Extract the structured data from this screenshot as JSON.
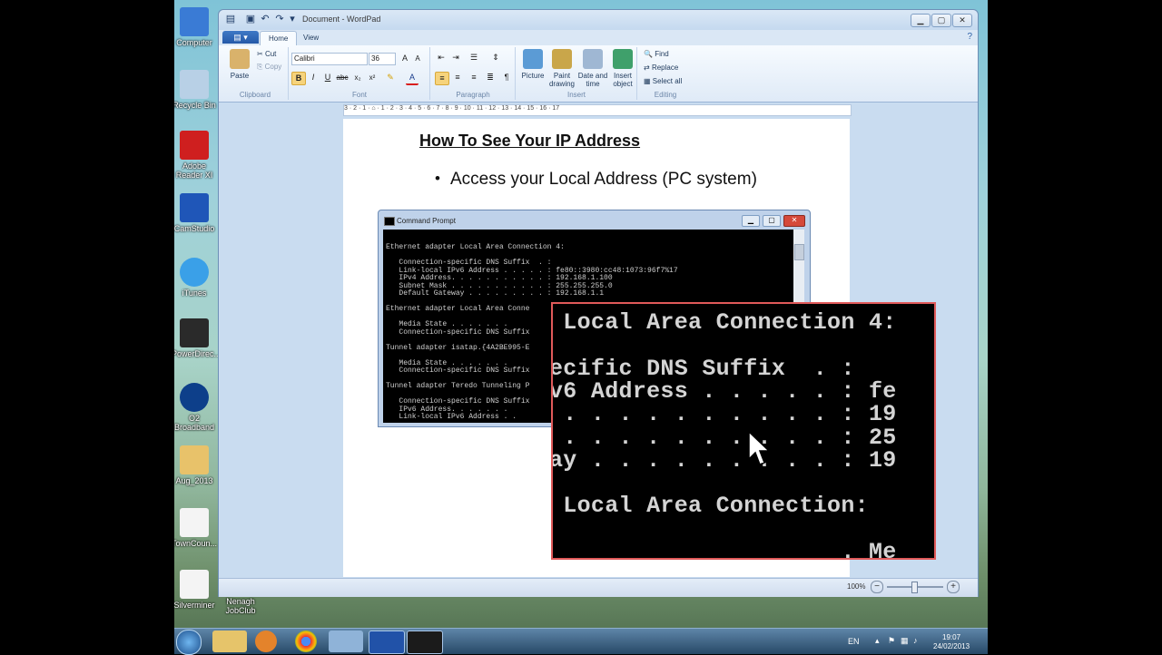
{
  "desktop": {
    "icons": [
      {
        "label": "Computer",
        "color": "#3a7bd5"
      },
      {
        "label": "Recycle Bin",
        "color": "#b8d0e6"
      },
      {
        "label": "Adobe Reader XI",
        "color": "#cf1f1f"
      },
      {
        "label": "CamStudio",
        "color": "#1f56b8"
      },
      {
        "label": "iTunes",
        "color": "#3aa0e8"
      },
      {
        "label": "PowerDirec...",
        "color": "#2a2a2a"
      },
      {
        "label": "O2 Broadband",
        "color": "#0d3f8a"
      },
      {
        "label": "Aug_2013",
        "color": "#e8c26a"
      },
      {
        "label": "TownCoun...",
        "color": "#f4f4f4"
      },
      {
        "label": "Silverminer",
        "color": "#f4f4f4"
      },
      {
        "label": "Nenagh JobClub",
        "color": "#f4f4f4"
      }
    ]
  },
  "wordpad": {
    "title": "Document - WordPad",
    "tabs": [
      "Home",
      "View"
    ],
    "ribbon": {
      "clipboard": {
        "paste": "Paste",
        "cut": "Cut",
        "copy": "Copy",
        "label": "Clipboard"
      },
      "font": {
        "family": "Calibri",
        "size": "36",
        "label": "Font"
      },
      "paragraph": {
        "label": "Paragraph"
      },
      "insert": {
        "picture": "Picture",
        "paint": "Paint drawing",
        "datetime": "Date and time",
        "object": "Insert object",
        "label": "Insert"
      },
      "editing": {
        "find": "Find",
        "replace": "Replace",
        "select_all": "Select all",
        "label": "Editing"
      }
    },
    "ruler": "3 · 2 · 1 · ⌂ · 1 · 2 · 3 · 4 · 5 · 6 · 7 · 8 · 9 · 10 · 11 · 12 · 13 · 14 · 15 · 16 · 17",
    "document": {
      "title": "How To See Your IP Address",
      "bullet": "Access your Local Address (PC system)"
    },
    "status": {
      "zoom": "100%"
    }
  },
  "cmd": {
    "title": "Command Prompt",
    "lines": [
      "Ethernet adapter Local Area Connection 4:",
      "",
      "   Connection-specific DNS Suffix  . :",
      "   Link-local IPv6 Address . . . . . : fe80::3980:cc48:1073:96f7%17",
      "   IPv4 Address. . . . . . . . . . . : 192.168.1.100",
      "   Subnet Mask . . . . . . . . . . . : 255.255.255.0",
      "   Default Gateway . . . . . . . . . : 192.168.1.1",
      "",
      "Ethernet adapter Local Area Conne",
      "",
      "   Media State . . . . . . .",
      "   Connection-specific DNS Suffix",
      "",
      "Tunnel adapter isatap.{4A2BE995-E",
      "",
      "   Media State . . . . . . .",
      "   Connection-specific DNS Suffix",
      "",
      "Tunnel adapter Teredo Tunneling P",
      "",
      "   Connection-specific DNS Suffix",
      "   IPv6 Address. . . . . . .",
      "   Link-local IPv6 Address . ."
    ]
  },
  "zoom": {
    "lines": [
      " Local Area Connection 4:",
      "",
      "ecific DNS Suffix  . :",
      "v6 Address . . . . . : fe",
      " . . . . . . . . . . : 19",
      " . . . . . . . . . . : 25",
      "ay . . . . . . . . . : 19",
      "",
      " Local Area Connection:",
      "",
      "                     . Me"
    ]
  },
  "taskbar": {
    "lang": "EN",
    "time": "19:07",
    "date": "24/02/2013"
  }
}
